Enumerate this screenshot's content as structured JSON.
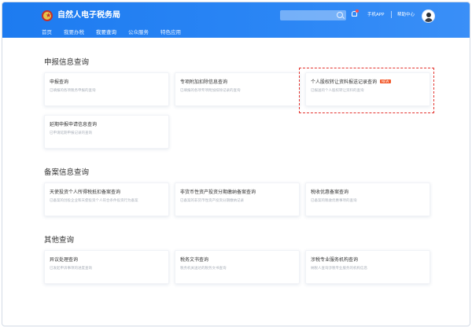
{
  "header": {
    "site_title": "自然人电子税务局",
    "nav": [
      "首页",
      "我要办税",
      "我要查询",
      "公众服务",
      "特色应用"
    ],
    "active_nav": "我要查询",
    "phone_app": "手机APP",
    "help_center": "帮助中心",
    "search_value": ""
  },
  "sections": [
    {
      "title": "申报信息查询",
      "cards": [
        {
          "title": "申报查询",
          "desc": "已填报的各项税务申报的查询"
        },
        {
          "title": "专项附加扣除信息查询",
          "desc": "已填报的各项专项附加扣除记录的查询"
        },
        {
          "title": "个人股权转让资料报送记录查询",
          "desc": "已报送的个人股权转让资料的查询",
          "badge": "NEW"
        },
        {
          "title": "延期申报申请信息查询",
          "desc": "已申请延期申报记录的查询"
        }
      ]
    },
    {
      "title": "备案信息查询",
      "cards": [
        {
          "title": "天使投资个人所得税抵扣备案查询",
          "desc": "已备案的创投企业和天使投资个人符合条件投资行为备案"
        },
        {
          "title": "非货币性资产投资分期缴纳备案查询",
          "desc": "已备案的非货币性资产投资分期缴纳记录"
        },
        {
          "title": "税收优惠备案查询",
          "desc": "已备案的税收优惠事项的查询"
        }
      ]
    },
    {
      "title": "其他查询",
      "cards": [
        {
          "title": "异议处理查询",
          "desc": "已发起申诉事项的进度查询"
        },
        {
          "title": "税务文书查询",
          "desc": "税务机关送达的税务文书查询"
        },
        {
          "title": "涉税专业服务机构查询",
          "desc": "纳税人查询涉税专业服务的机构信息"
        }
      ]
    }
  ],
  "colors": {
    "header_blue": "#2b86f5",
    "badge": "#f25a2c",
    "highlight": "#e3342f"
  }
}
